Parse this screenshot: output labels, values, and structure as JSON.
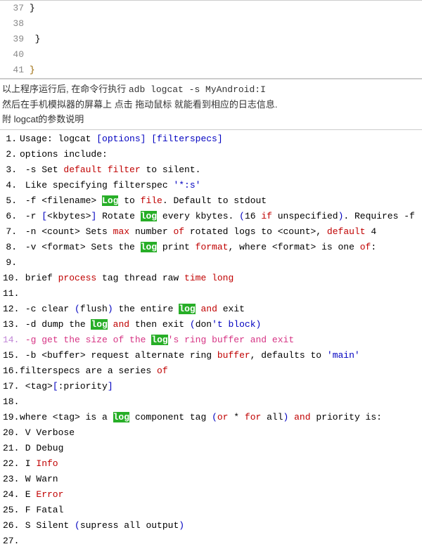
{
  "top": {
    "lines": [
      {
        "n": "37",
        "t": "}"
      },
      {
        "n": "38",
        "t": ""
      },
      {
        "n": "39",
        "t": " }"
      },
      {
        "n": "40",
        "t": ""
      },
      {
        "n": "41",
        "t": "}"
      }
    ]
  },
  "desc": {
    "l1a": "以上程序运行后, 在命令行执行  ",
    "l1b": "adb logcat -s MyAndroid:I",
    "l2": "然后在手机模拟器的屏幕上 点击 拖动鼠标 就能看到相应的日志信息.",
    "l3": "附 logcat的参数说明"
  },
  "doc": {
    "1": {
      "pre": "Usage: logcat ",
      "a": "[options]",
      "b": " [filterspecs]"
    },
    "2": "options include:",
    "3": {
      "a": "-s Set ",
      "b": "default",
      "c": " filter",
      "d": " to silent."
    },
    "4": {
      "a": " Like specifying filterspec ",
      "b": "'*:s'"
    },
    "5": {
      "a": "-f <filename> ",
      "b": "Log",
      "c": " to ",
      "d": "file",
      "e": ". Default to stdout"
    },
    "6": {
      "a": "-r ",
      "b": "[",
      "c": "<kbytes>",
      "d": "]",
      "e": " Rotate ",
      "f": "log",
      "g": " every kbytes. ",
      "h": "(",
      "i": "16 ",
      "j": "if",
      "k": " unspecified",
      "l": ")",
      "m": ". Requires -f"
    },
    "7": {
      "a": "-n <count> Sets ",
      "b": "max",
      "c": " number ",
      "d": "of",
      "e": " rotated logs to <count>, ",
      "f": "default",
      "g": " 4"
    },
    "8": {
      "a": "-v <format> Sets the ",
      "b": "log",
      "c": " print ",
      "d": "format",
      "e": ", where <format> is one ",
      "f": "of",
      "g": ":"
    },
    "9": "",
    "10": {
      "a": " brief ",
      "b": "process",
      "c": " tag thread raw ",
      "d": "time",
      "e": " long"
    },
    "11": "",
    "12": {
      "a": "-c clear ",
      "b": "(",
      "c": "flush",
      "d": ")",
      "e": " the entire ",
      "f": "log",
      "g": " and",
      "h": " exit"
    },
    "13": {
      "a": "-d dump the ",
      "b": "log",
      "c": " and",
      "d": " then exit ",
      "e": "(",
      "f": "don",
      "g": "'t block)"
    },
    "14": {
      "a": "-g get the size ",
      "b": "of",
      "c": " the ",
      "d": "log",
      "e": "'s ring buffer ",
      "f": "and",
      "g": " exit"
    },
    "15": {
      "a": "-b <buffer> request alternate ring buffer, defaults to ",
      "b": "'main'"
    },
    "16": {
      "a": "filterspecs are a series ",
      "b": "of"
    },
    "17": {
      "a": " <tag>",
      "b": "[",
      "c": ":priority",
      "d": "]"
    },
    "18": "",
    "19": {
      "a": "where <tag> is a ",
      "b": "log",
      "c": " component tag ",
      "d": "(",
      "e": "or",
      "f": " * ",
      "g": "for",
      "h": " all",
      "i": ")",
      "j": " and",
      "k": " priority is:"
    },
    "20": " V Verbose",
    "21": " D Debug",
    "22": {
      "a": " I ",
      "b": "Info"
    },
    "23": " W Warn",
    "24": {
      "a": " E ",
      "b": "Error"
    },
    "25": " F Fatal",
    "26": {
      "a": " S Silent ",
      "b": "(",
      "c": "supress all output",
      "d": ")"
    },
    "27": ""
  }
}
